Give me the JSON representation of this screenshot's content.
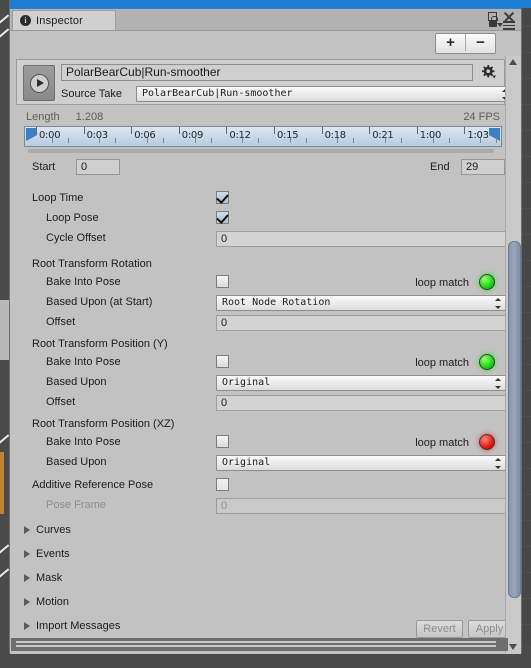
{
  "window": {
    "tab_label": "Inspector",
    "tab_icon": "info-icon",
    "maximize_icon": "maximize-icon",
    "close_icon": "close-icon",
    "lock_icon": "lock-icon",
    "menu_icon": "hamburger-menu-icon"
  },
  "toolbar": {
    "add_label": "+",
    "remove_label": "−"
  },
  "clip": {
    "play_icon": "play-icon",
    "gear_icon": "gear-icon",
    "name": "PolarBearCub|Run-smoother",
    "source_take_label": "Source Take",
    "source_take_value": "PolarBearCub|Run-smoother"
  },
  "timeline": {
    "length_label": "Length",
    "length_value": "1.208",
    "fps": "24 FPS",
    "ticks": [
      "0:00",
      "0:03",
      "0:06",
      "0:09",
      "0:12",
      "0:15",
      "0:18",
      "0:21",
      "1:00",
      "1:03"
    ]
  },
  "range": {
    "start_label": "Start",
    "start_value": "0",
    "end_label": "End",
    "end_value": "29"
  },
  "loop": {
    "loop_time_label": "Loop Time",
    "loop_time_checked": true,
    "loop_pose_label": "Loop Pose",
    "loop_pose_checked": true,
    "cycle_offset_label": "Cycle Offset",
    "cycle_offset_value": "0"
  },
  "root_rotation": {
    "title": "Root Transform Rotation",
    "bake_label": "Bake Into Pose",
    "bake_checked": false,
    "loop_match_label": "loop match",
    "loop_match_color": "#13d612",
    "based_upon_label": "Based Upon (at Start)",
    "based_upon_value": "Root Node Rotation",
    "offset_label": "Offset",
    "offset_value": "0"
  },
  "root_position_y": {
    "title": "Root Transform Position (Y)",
    "bake_label": "Bake Into Pose",
    "bake_checked": false,
    "loop_match_label": "loop match",
    "loop_match_color": "#13d612",
    "based_upon_label": "Based Upon",
    "based_upon_value": "Original",
    "offset_label": "Offset",
    "offset_value": "0"
  },
  "root_position_xz": {
    "title": "Root Transform Position (XZ)",
    "bake_label": "Bake Into Pose",
    "bake_checked": false,
    "loop_match_label": "loop match",
    "loop_match_color": "#e81414",
    "based_upon_label": "Based Upon",
    "based_upon_value": "Original"
  },
  "additive": {
    "label": "Additive Reference Pose",
    "checked": false,
    "pose_frame_label": "Pose Frame",
    "pose_frame_value": "0"
  },
  "foldouts": [
    {
      "label": "Curves"
    },
    {
      "label": "Events"
    },
    {
      "label": "Mask"
    },
    {
      "label": "Motion"
    },
    {
      "label": "Import Messages"
    }
  ],
  "footer": {
    "revert_label": "Revert",
    "apply_label": "Apply"
  }
}
